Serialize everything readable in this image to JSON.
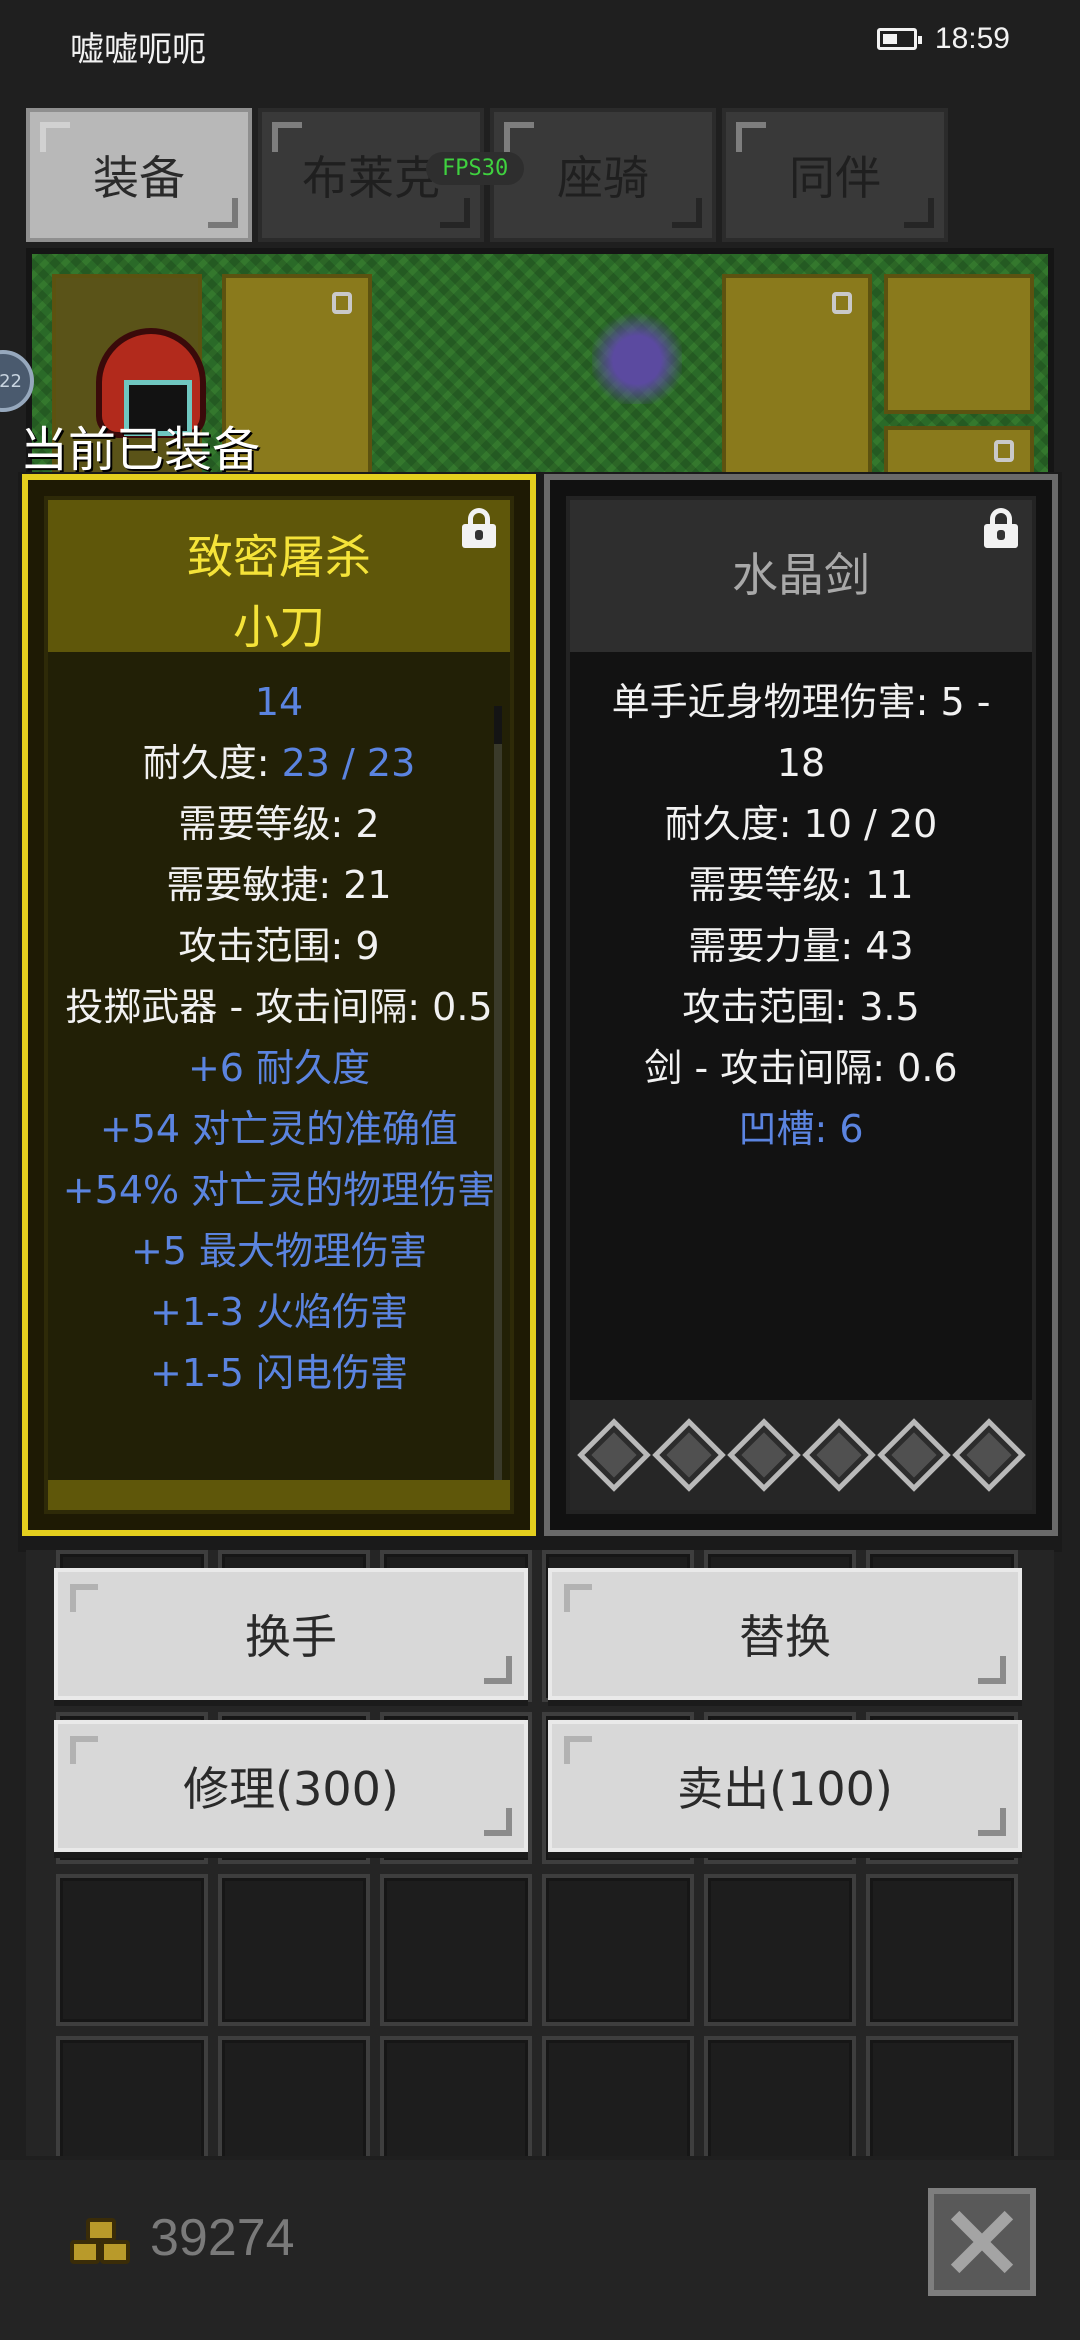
{
  "status_bar": {
    "app_name": "嘘嘘呃呃",
    "time": "18:59"
  },
  "tabs": [
    {
      "label": "装备",
      "active": true
    },
    {
      "label": "布莱克",
      "active": false
    },
    {
      "label": "座骑",
      "active": false
    },
    {
      "label": "同伴",
      "active": false
    }
  ],
  "fps": "FPS30",
  "avatar_badge": "22",
  "equipped_label": "当前已装备",
  "equipped_item": {
    "title_line1": "致密屠杀",
    "title_line2": "小刀",
    "stats": [
      {
        "text": "14",
        "color": "blue"
      },
      {
        "label": "耐久度: ",
        "value": "23 / 23"
      },
      {
        "text": "需要等级: 2",
        "color": "white"
      },
      {
        "text": "需要敏捷: 21",
        "color": "white"
      },
      {
        "text": "攻击范围: 9",
        "color": "white"
      },
      {
        "text": "投掷武器 - 攻击间隔: 0.5",
        "color": "white"
      },
      {
        "text": "+6 耐久度",
        "color": "blue"
      },
      {
        "text": "+54 对亡灵的准确值",
        "color": "blue"
      },
      {
        "text": "+54% 对亡灵的物理伤害",
        "color": "blue"
      },
      {
        "text": "+5 最大物理伤害",
        "color": "blue"
      },
      {
        "text": "+1-3 火焰伤害",
        "color": "blue"
      },
      {
        "text": "+1-5 闪电伤害",
        "color": "blue"
      }
    ]
  },
  "compare_item": {
    "title": "水晶剑",
    "stats": [
      {
        "text": "单手近身物理伤害: 5 -",
        "color": "white"
      },
      {
        "text": "18",
        "color": "white"
      },
      {
        "text": "耐久度: 10 / 20",
        "color": "white"
      },
      {
        "text": "需要等级: 11",
        "color": "white"
      },
      {
        "text": "需要力量: 43",
        "color": "white"
      },
      {
        "text": "攻击范围: 3.5",
        "color": "white"
      },
      {
        "text": "剑 - 攻击间隔: 0.6",
        "color": "white"
      },
      {
        "text": "凹槽: 6",
        "color": "blue"
      }
    ],
    "socket_count": 6
  },
  "buttons": {
    "swap_hand": "换手",
    "replace": "替换",
    "repair": "修理(300)",
    "sell": "卖出(100)"
  },
  "gold": "39274",
  "colors": {
    "legendary_yellow": "#f5e339",
    "magic_blue": "#5b84e0",
    "panel_border_gold": "#e4cf1e"
  }
}
